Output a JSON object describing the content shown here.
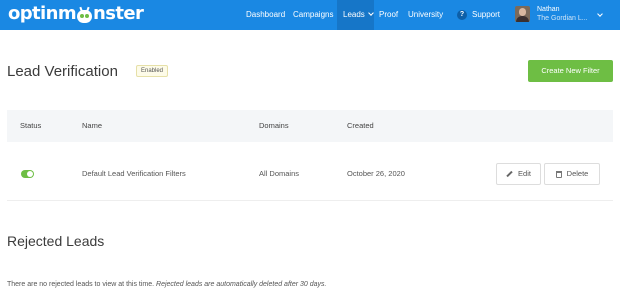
{
  "brand": {
    "logo_prefix": "optinm",
    "logo_suffix": "nster",
    "color": "#1a88e3",
    "accent": "#6ebe44"
  },
  "nav": {
    "items": [
      {
        "label": "Dashboard"
      },
      {
        "label": "Campaigns"
      },
      {
        "label": "Leads",
        "active": true
      },
      {
        "label": "Proof"
      },
      {
        "label": "University"
      },
      {
        "label": "Support"
      }
    ]
  },
  "user": {
    "name": "Nathan",
    "org": "The Gordian L..."
  },
  "header": {
    "title": "Lead Verification",
    "badge": "Enabled",
    "create_button": "Create New Filter"
  },
  "table": {
    "columns": [
      "Status",
      "Name",
      "Domains",
      "Created"
    ],
    "rows": [
      {
        "status": "on",
        "name": "Default Lead Verification Filters",
        "domains": "All Domains",
        "created": "October 26, 2020",
        "edit_label": "Edit",
        "delete_label": "Delete"
      }
    ]
  },
  "rejected": {
    "title": "Rejected Leads",
    "note": "There are no rejected leads to view at this time.",
    "note_italic": "Rejected leads are automatically deleted after 30 days."
  }
}
